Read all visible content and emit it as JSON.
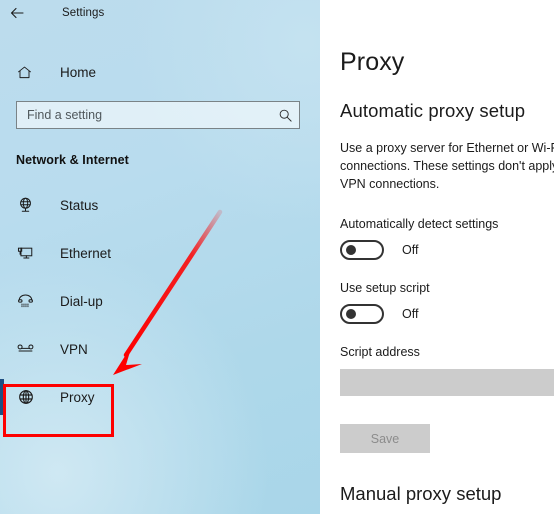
{
  "window": {
    "title": "Settings",
    "back_icon": "back-arrow-icon"
  },
  "sidebar": {
    "home": {
      "label": "Home",
      "icon": "home-icon"
    },
    "search": {
      "placeholder": "Find a setting",
      "value": "",
      "icon": "search-icon"
    },
    "section_title": "Network & Internet",
    "items": [
      {
        "label": "Status",
        "icon": "globe-stand-icon",
        "selected": false
      },
      {
        "label": "Ethernet",
        "icon": "monitor-icon",
        "selected": false
      },
      {
        "label": "Dial-up",
        "icon": "telephone-icon",
        "selected": false
      },
      {
        "label": "VPN",
        "icon": "vpn-icon",
        "selected": false
      },
      {
        "label": "Proxy",
        "icon": "globe-icon",
        "selected": true
      }
    ]
  },
  "annotation": {
    "highlight_color": "#fe0000",
    "arrow_color": "#fe0000",
    "target": "Proxy"
  },
  "content": {
    "page_title": "Proxy",
    "automatic_section": {
      "heading": "Automatic proxy setup",
      "description": "Use a proxy server for Ethernet or Wi-Fi connections. These settings don't apply to VPN connections.",
      "auto_detect": {
        "label": "Automatically detect settings",
        "state": "Off"
      },
      "setup_script": {
        "label": "Use setup script",
        "state": "Off"
      },
      "script_address": {
        "label": "Script address",
        "value": ""
      },
      "save_label": "Save"
    },
    "manual_section": {
      "heading": "Manual proxy setup"
    }
  },
  "colors": {
    "sidebar_bg": "#b3dcee",
    "accent": "#1f4f82",
    "annotation_red": "#fe0000",
    "disabled_grey": "#cccccc"
  }
}
